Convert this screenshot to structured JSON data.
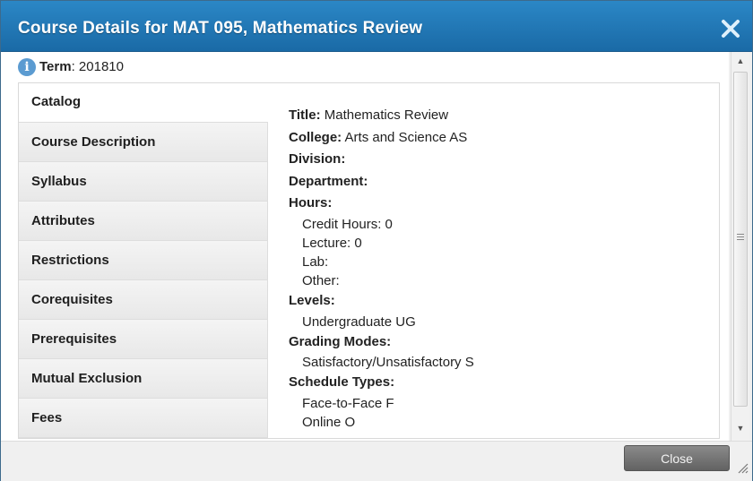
{
  "dialog": {
    "title": "Course Details for MAT 095, Mathematics Review",
    "close_icon": "close-icon"
  },
  "term": {
    "label": "Term",
    "separator": ":",
    "value": "201810",
    "icon": "info-icon"
  },
  "tabs": [
    {
      "label": "Catalog",
      "active": true
    },
    {
      "label": "Course Description"
    },
    {
      "label": "Syllabus"
    },
    {
      "label": "Attributes"
    },
    {
      "label": "Restrictions"
    },
    {
      "label": "Corequisites"
    },
    {
      "label": "Prerequisites"
    },
    {
      "label": "Mutual Exclusion"
    },
    {
      "label": "Fees"
    }
  ],
  "catalog": {
    "title_label": "Title:",
    "title_value": "Mathematics Review",
    "college_label": "College:",
    "college_value": "Arts and Science AS",
    "division_label": "Division:",
    "department_label": "Department:",
    "hours_label": "Hours:",
    "hours": [
      "Credit Hours: 0",
      "Lecture: 0",
      "Lab:",
      "Other:"
    ],
    "levels_label": "Levels:",
    "levels": [
      "Undergraduate UG"
    ],
    "grading_label": "Grading Modes:",
    "grading": [
      "Satisfactory/Unsatisfactory S"
    ],
    "schedule_label": "Schedule Types:",
    "schedule": [
      "Face-to-Face F",
      "Online O"
    ]
  },
  "footer": {
    "close_label": "Close"
  },
  "colors": {
    "titlebar": "#1f77b8",
    "close_button": "#707070"
  }
}
